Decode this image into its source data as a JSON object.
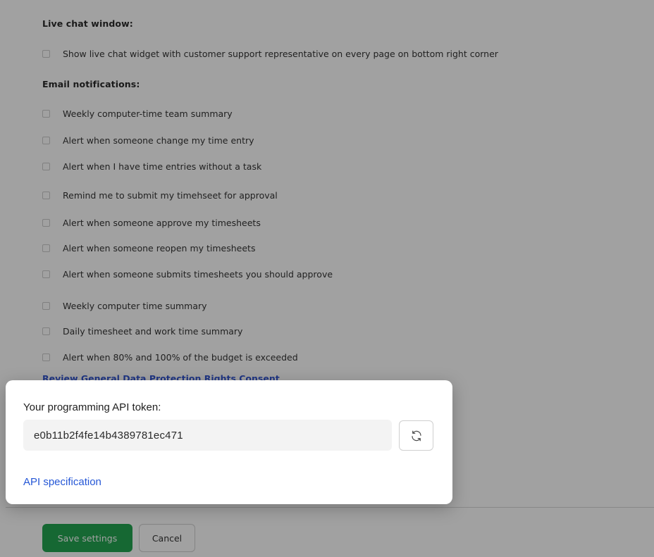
{
  "settings": {
    "live_chat_heading": "Live chat window:",
    "live_chat_option": "Show live chat widget with customer support representative on every page on bottom right corner",
    "email_heading": "Email notifications:",
    "email_options": [
      "Weekly computer-time team summary",
      "Alert when someone change my time entry",
      "Alert when I have time entries without a task",
      "Remind me to submit my timehseet for approval",
      "Alert when someone approve my timesheets",
      "Alert when someone reopen my timesheets",
      "Alert when someone submits timesheets you should approve",
      "Weekly computer time summary",
      "Daily timesheet and work time summary",
      "Alert when 80% and 100% of the budget is exceeded"
    ],
    "gdpr_link": "Review General Data Protection Rights Consent"
  },
  "token_card": {
    "label": "Your programming API token:",
    "token": "e0b11b2f4fe14b4389781ec471",
    "link": "API specification",
    "refresh_icon": "refresh-icon"
  },
  "footer": {
    "save_label": "Save settings",
    "cancel_label": "Cancel"
  },
  "colors": {
    "save_button": "#18a048",
    "link": "#2557d6"
  }
}
